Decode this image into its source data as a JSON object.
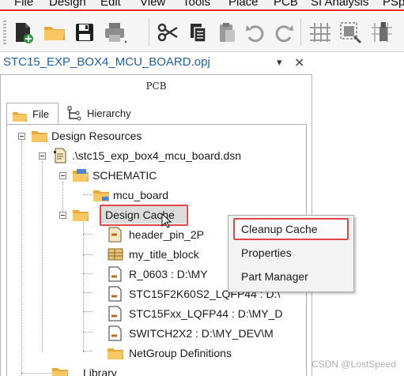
{
  "menu": [
    "File",
    "Design",
    "Edit",
    "View",
    "Tools",
    "Place",
    "PCB",
    "SI Analysis",
    "PSp"
  ],
  "toolbar_icons": [
    "new-file-icon",
    "open-folder-icon",
    "save-icon",
    "print-icon",
    "cut-icon",
    "copy-icon",
    "paste-icon",
    "undo-icon",
    "redo-icon",
    "grid-icon",
    "select-area-icon",
    "snap-icon"
  ],
  "project": {
    "title": "STC15_EXP_BOX4_MCU_BOARD.opj",
    "pin_label": "▾",
    "close_label": "×"
  },
  "pane": {
    "title": "PCB",
    "tabs": [
      {
        "label": "File",
        "active": true
      },
      {
        "label": "Hierarchy",
        "active": false
      }
    ]
  },
  "tree": {
    "design_resources": "Design Resources",
    "dsn_file": ".\\stc15_exp_box4_mcu_board.dsn",
    "schematic": "SCHEMATIC",
    "mcu_board": "mcu_board",
    "design_cache": "Design Cache",
    "cache_items": [
      "header_pin_2P",
      "my_title_block",
      "R_0603 : D:\\MY",
      "STC15F2K60S2_LQFP44 : D:\\",
      "STC15Fxx_LQFP44 : D:\\MY_D",
      "SWITCH2X2 : D:\\MY_DEV\\M",
      "NetGroup Definitions"
    ],
    "library": "Library"
  },
  "context_menu": {
    "items": [
      "Cleanup Cache",
      "Properties",
      "Part Manager"
    ],
    "highlighted_index": 0
  },
  "colors": {
    "highlight": "#e04848",
    "folder": "#f0b94a",
    "title_link": "#1f5fa8"
  },
  "watermark": "CSDN @LostSpeed"
}
